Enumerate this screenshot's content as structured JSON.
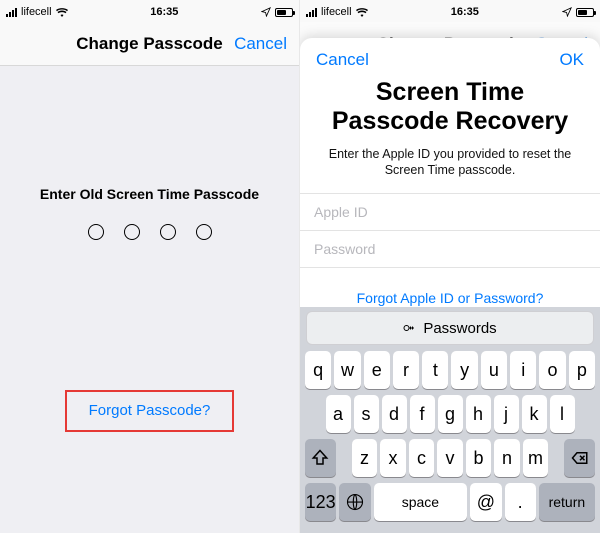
{
  "left": {
    "status": {
      "carrier": "lifecell",
      "time": "16:35"
    },
    "nav": {
      "title": "Change Passcode",
      "cancel": "Cancel"
    },
    "prompt": "Enter Old Screen Time Passcode",
    "forgot": "Forgot Passcode?"
  },
  "right": {
    "status": {
      "carrier": "lifecell",
      "time": "16:35"
    },
    "nav": {
      "title": "Change Passcode",
      "cancel": "Cancel"
    },
    "sheet": {
      "cancel": "Cancel",
      "ok": "OK",
      "title_line1": "Screen Time",
      "title_line2": "Passcode Recovery",
      "subtitle": "Enter the Apple ID you provided to reset the Screen Time passcode.",
      "apple_id_placeholder": "Apple ID",
      "password_placeholder": "Password",
      "forgot_id": "Forgot Apple ID or Password?"
    },
    "keyboard": {
      "bar": "Passwords",
      "row1": [
        "q",
        "w",
        "e",
        "r",
        "t",
        "y",
        "u",
        "i",
        "o",
        "p"
      ],
      "row2": [
        "a",
        "s",
        "d",
        "f",
        "g",
        "h",
        "j",
        "k",
        "l"
      ],
      "row3": [
        "z",
        "x",
        "c",
        "v",
        "b",
        "n",
        "m"
      ],
      "num_key": "123",
      "space": "space",
      "at": "@",
      "dot": ".",
      "return": "return"
    }
  }
}
